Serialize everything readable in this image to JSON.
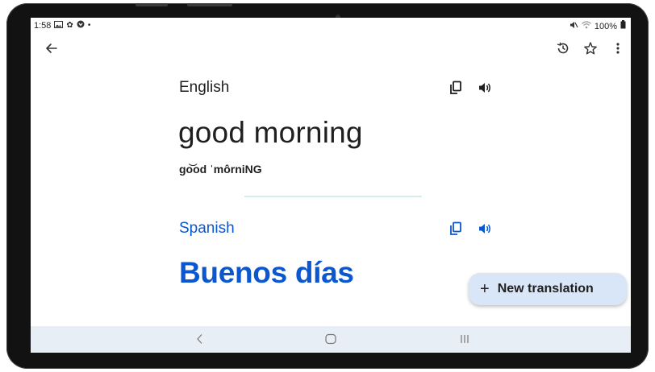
{
  "status_bar": {
    "time": "1:58",
    "battery": "100%",
    "left_icons": [
      "gallery-icon",
      "settings-icon",
      "app-icon",
      "dot-icon"
    ],
    "right_icons": [
      "mute-icon",
      "wifi-icon",
      "battery-icon"
    ]
  },
  "toolbar": {
    "back_icon": "arrow-left-icon",
    "history_icon": "history-icon",
    "star_icon": "star-icon",
    "more_icon": "more-vert-icon"
  },
  "source": {
    "language": "English",
    "text": "good morning",
    "transliteration": "go͝od ˈmôrniNG",
    "copy_icon": "copy-icon",
    "listen_icon": "speaker-icon"
  },
  "target": {
    "language": "Spanish",
    "text": "Buenos días",
    "copy_icon": "copy-icon",
    "listen_icon": "speaker-icon"
  },
  "fab": {
    "icon": "plus-icon",
    "label": "New translation"
  },
  "nav_bar": {
    "back_icon": "nav-back-icon",
    "home_icon": "nav-home-icon",
    "recents_icon": "nav-recents-icon"
  },
  "colors": {
    "accent": "#0b57d0",
    "fab_background": "#d9e6f8",
    "nav_background": "#e8eef6",
    "divider": "#d7ecec",
    "bezel": "#121212"
  }
}
